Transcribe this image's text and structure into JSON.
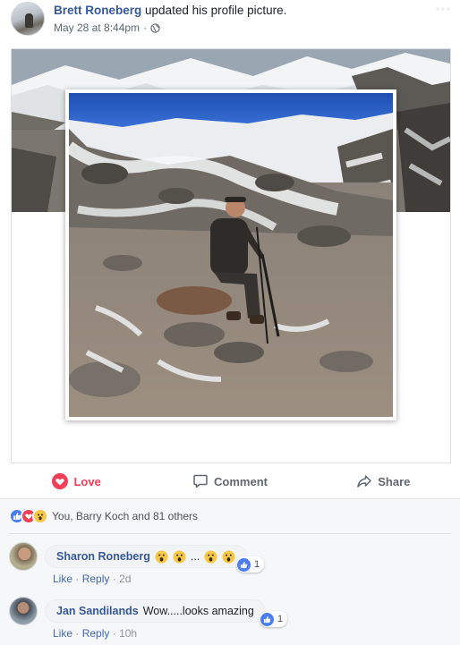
{
  "post": {
    "author": "Brett Roneberg",
    "action_text": "updated his profile picture.",
    "timestamp": "May 28 at 8:44pm",
    "separator": "·",
    "privacy_icon": "globe-icon"
  },
  "actions": {
    "love_label": "Love",
    "comment_label": "Comment",
    "share_label": "Share"
  },
  "reactions": {
    "icons": [
      "like-icon",
      "love-icon",
      "wow-icon"
    ],
    "summary": "You, Barry Koch and 81 others"
  },
  "comments": [
    {
      "author": "Sharon Roneberg",
      "text": "...",
      "reaction_count": "1",
      "like_label": "Like",
      "reply_label": "Reply",
      "time": "2d",
      "separator": "·"
    },
    {
      "author": "Jan Sandilands",
      "text": "Wow.....looks amazing",
      "reaction_count": "1",
      "like_label": "Like",
      "reply_label": "Reply",
      "time": "10h",
      "separator": "·"
    }
  ],
  "colors": {
    "link_blue": "#365899",
    "love_red": "#f33e58",
    "like_blue": "#4a7cf3",
    "wow_yellow": "#f7c746",
    "muted_gray": "#616770"
  }
}
